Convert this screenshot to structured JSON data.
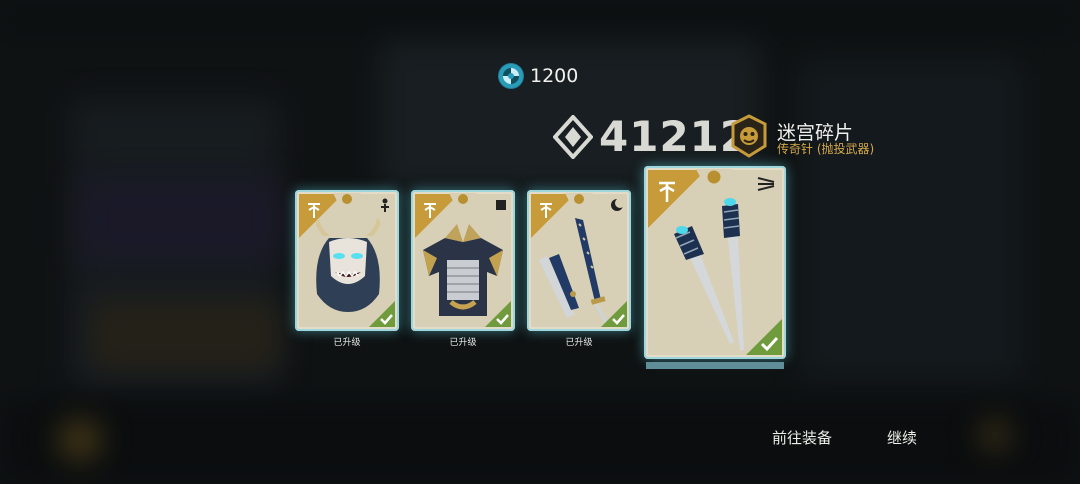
{
  "currency": {
    "icon": "spiral-orb-icon",
    "amount": "1200"
  },
  "reward": {
    "count": "41212",
    "icon": "diamond-shard-icon",
    "badge_icon": "demon-mask-badge-icon",
    "title": "迷宫碎片",
    "subtitle": "传奇针 (抛投武器)",
    "subtitle_color": "#d6a84a"
  },
  "cards": [
    {
      "name": "oni-mask",
      "caption": "已升级",
      "type_icon": "figure-icon",
      "art": "oni-mask-helmet"
    },
    {
      "name": "armor",
      "caption": "已升级",
      "type_icon": "square-icon",
      "art": "samurai-armor"
    },
    {
      "name": "katana",
      "caption": "已升级",
      "type_icon": "crescent-icon",
      "art": "katana-and-sheath"
    }
  ],
  "featured_card": {
    "name": "throwing-needles",
    "type_icon": "triple-lines-icon",
    "art": "twin-throwing-needles",
    "progress": 1.0
  },
  "colors": {
    "accent_glow": "#9fd6dc",
    "corner_gold": "#c79a3a",
    "check_green": "#6f9b3c"
  },
  "buttons": {
    "equip": "前往装备",
    "continue": "继续"
  }
}
